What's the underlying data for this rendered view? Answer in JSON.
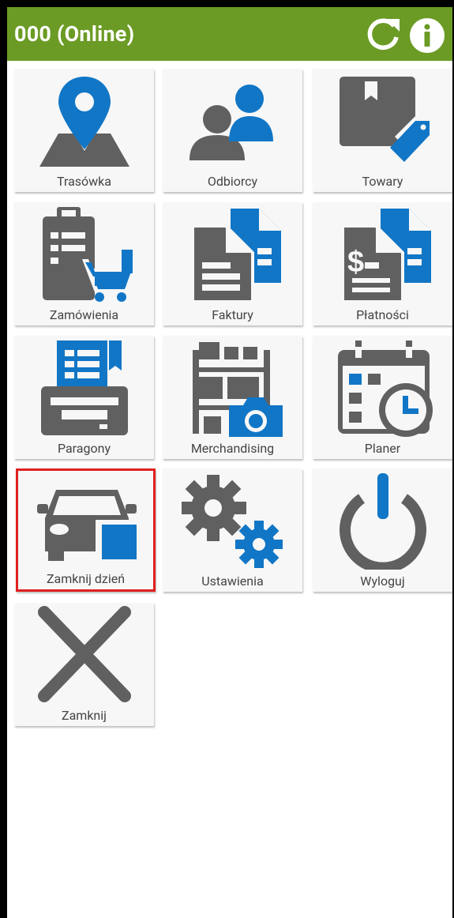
{
  "header": {
    "title": "000 (Online)",
    "refresh_icon": "refresh-icon",
    "info_icon": "info-icon"
  },
  "colors": {
    "header_bg": "#6b9b25",
    "icon_gray": "#606060",
    "icon_blue": "#1176c6",
    "selection": "#e02020"
  },
  "tiles": [
    {
      "label": "Trasówka",
      "icon": "map-pin-icon"
    },
    {
      "label": "Odbiorcy",
      "icon": "users-icon"
    },
    {
      "label": "Towary",
      "icon": "product-tag-icon"
    },
    {
      "label": "Zamówienia",
      "icon": "order-cart-icon"
    },
    {
      "label": "Faktury",
      "icon": "invoice-documents-icon"
    },
    {
      "label": "Płatności",
      "icon": "payment-documents-icon"
    },
    {
      "label": "Paragony",
      "icon": "receipt-printer-icon"
    },
    {
      "label": "Merchandising",
      "icon": "merchandising-camera-icon"
    },
    {
      "label": "Planer",
      "icon": "calendar-clock-icon"
    },
    {
      "label": "Zamknij dzień",
      "icon": "close-day-car-icon",
      "selected": true
    },
    {
      "label": "Ustawienia",
      "icon": "settings-gears-icon"
    },
    {
      "label": "Wyloguj",
      "icon": "power-icon"
    },
    {
      "label": "Zamknij",
      "icon": "close-x-icon"
    }
  ]
}
